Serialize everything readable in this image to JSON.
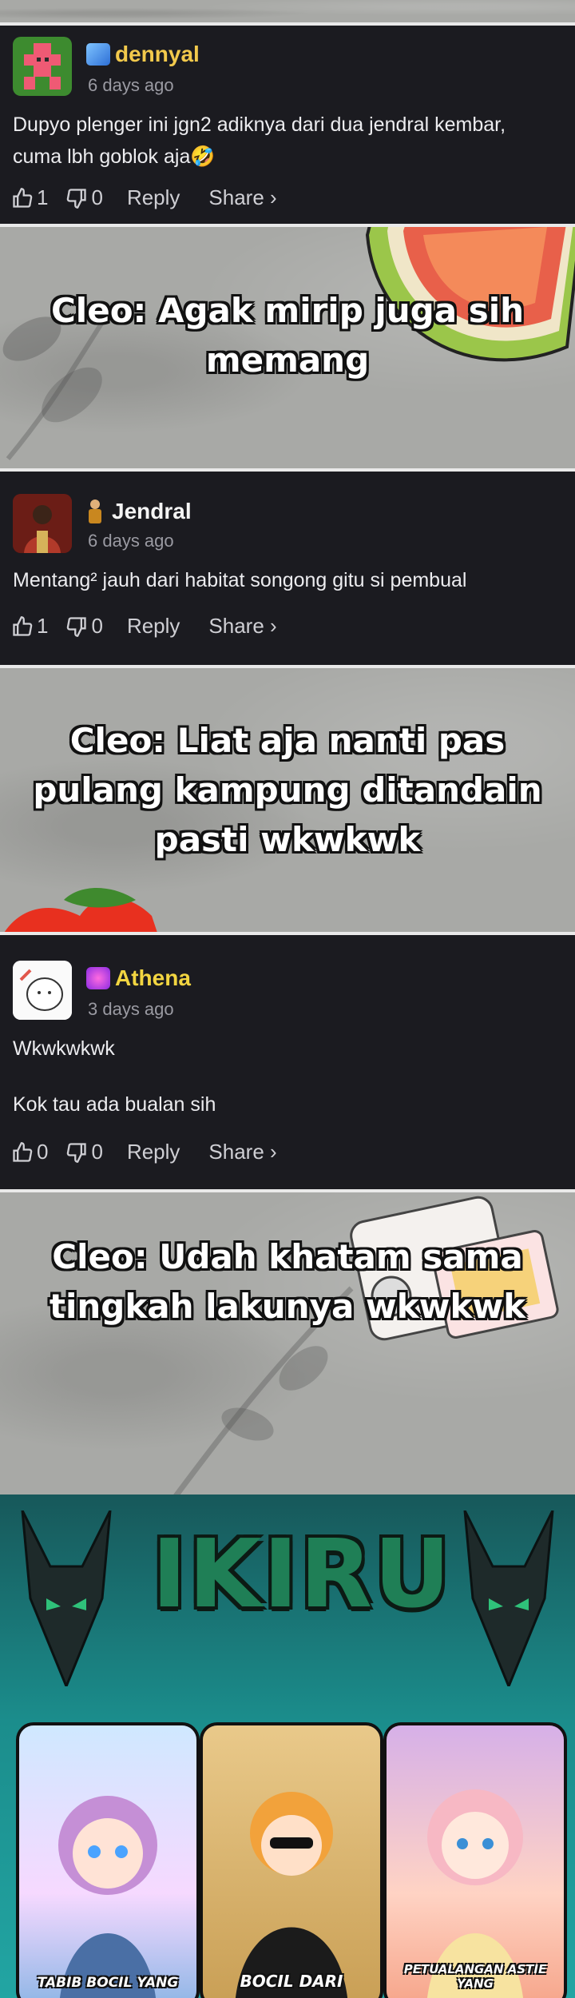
{
  "comments": [
    {
      "username": "dennyal",
      "badge_icon": "crystal-badge-icon",
      "username_color": "#f2c94c",
      "time": "6 days ago",
      "lines": [
        "Dupyo plenger ini jgn2 adiknya dari dua jendral kembar,",
        "cuma lbh goblok aja🤣"
      ],
      "likes": "1",
      "dislikes": "0",
      "reply_label": "Reply",
      "share_label": "Share ›"
    },
    {
      "username": "Jendral",
      "badge_icon": "figure-badge-icon",
      "username_color": "#f4f4f4",
      "time": "6 days ago",
      "lines": [
        "Mentang² jauh dari habitat songong gitu si pembual"
      ],
      "likes": "1",
      "dislikes": "0",
      "reply_label": "Reply",
      "share_label": "Share ›"
    },
    {
      "username": "Athena",
      "badge_icon": "purple-crest-badge-icon",
      "username_color": "#f2d541",
      "time": "3 days ago",
      "lines": [
        "Wkwkwkwk",
        "Kok tau ada bualan sih"
      ],
      "likes": "0",
      "dislikes": "0",
      "reply_label": "Reply",
      "share_label": "Share ›"
    }
  ],
  "captions": [
    [
      "Cleo: Agak mirip juga sih",
      "memang"
    ],
    [
      "Cleo: Liat aja nanti pas",
      "pulang kampung ditandain",
      "pasti wkwkwk"
    ],
    [
      "Cleo: Udah khatam sama",
      "tingkah lakunya wkwkwk"
    ]
  ],
  "banner": {
    "logo": "IKIRU",
    "cards": [
      {
        "title_line1": "TABIB BOCIL YANG",
        "title_line2": ""
      },
      {
        "title_line1": "BOCIL DARI",
        "title_line2": ""
      },
      {
        "title_line1": "PETUALANGAN ASTIE YANG",
        "title_line2": ""
      }
    ]
  },
  "colors": {
    "comment_bg": "#1b1b20",
    "panel_bg": "#a8a9a6",
    "banner_teal": "#1b8d8c",
    "logo_green": "#1f7f56"
  }
}
